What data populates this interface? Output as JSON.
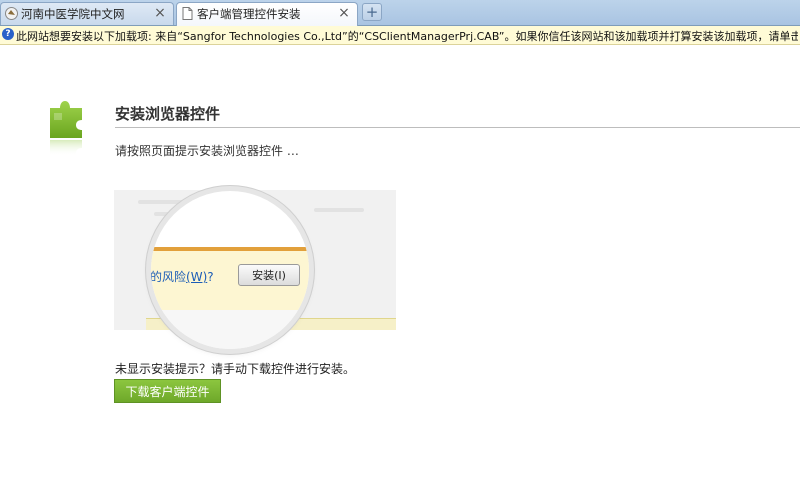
{
  "tabs": [
    {
      "title": "河南中医学院中文网",
      "close": "×"
    },
    {
      "title": "客户端管理控件安装",
      "close": "×"
    }
  ],
  "new_tab": "+",
  "infobar": {
    "text": "此网站想要安装以下加载项: 来自“Sangfor Technologies Co.,Ltd”的“CSClientManagerPrj.CAB”。如果你信任该网站和该加载项并打算安装该加载项，请单击此处..."
  },
  "content": {
    "title": "安装浏览器控件",
    "instruction": "请按照页面提示安装浏览器控件 …",
    "illustration": {
      "risk_text": "的风险",
      "risk_shortcut": "(W)",
      "risk_suffix": "?",
      "install_label": "安装(I)"
    },
    "no_prompt_text": "未显示安装提示？请手动下载控件进行安装。",
    "download_button": "下载客户端控件"
  },
  "colors": {
    "accent_green": "#7ab532",
    "infobar_bg": "#fffbd6",
    "tab_strip": "#bcd3ea"
  }
}
